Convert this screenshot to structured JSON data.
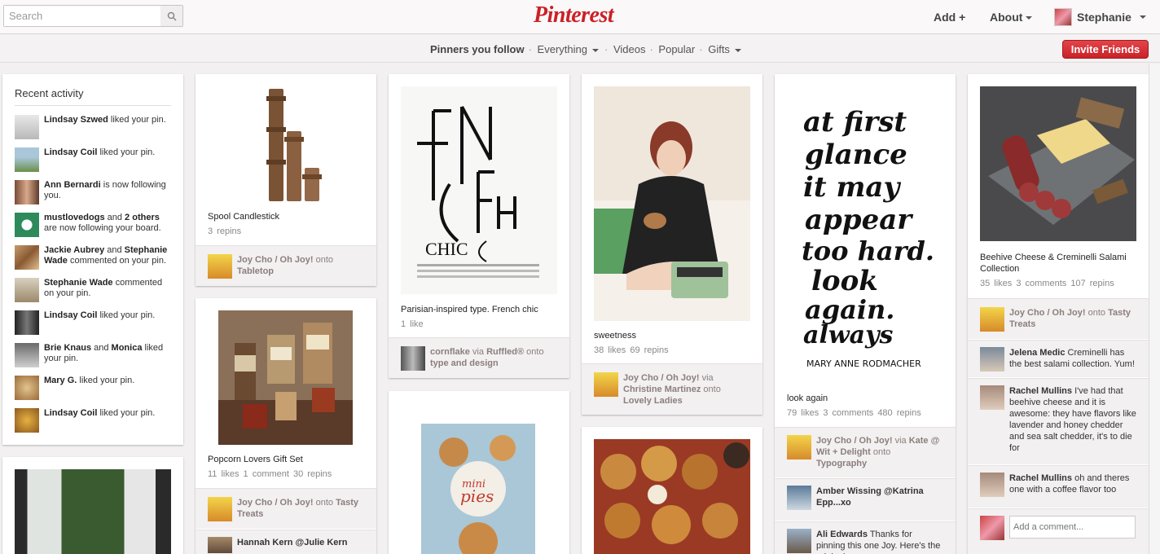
{
  "header": {
    "search_placeholder": "Search",
    "logo": "Pinterest",
    "add_label": "Add +",
    "about_label": "About",
    "user_name": "Stephanie"
  },
  "subnav": {
    "links": [
      "Pinners you follow",
      "Everything",
      "Videos",
      "Popular",
      "Gifts"
    ],
    "invite_label": "Invite Friends"
  },
  "recent_activity": {
    "title": "Recent activity",
    "items": [
      {
        "actor": "Lindsay Szwed",
        "text": " liked your pin."
      },
      {
        "actor": "Lindsay Coil",
        "text": " liked your pin."
      },
      {
        "actor": "Ann Bernardi",
        "text": " is now following you."
      },
      {
        "actor": "mustlovedogs",
        "text": " and ",
        "actor2": "2 others",
        "text2": " are now following your board."
      },
      {
        "actor": "Jackie Aubrey",
        "text": " and ",
        "actor2": "Stephanie Wade",
        "text2": " commented on your pin."
      },
      {
        "actor": "Stephanie Wade",
        "text": " commented on your pin."
      },
      {
        "actor": "Lindsay Coil",
        "text": " liked your pin."
      },
      {
        "actor": "Brie Knaus",
        "text": " and ",
        "actor2": "Monica",
        "text2": " liked your pin."
      },
      {
        "actor": "Mary G.",
        "text": " liked your pin."
      },
      {
        "actor": "Lindsay Coil",
        "text": " liked your pin."
      }
    ]
  },
  "pins": {
    "spool": {
      "title": "Spool Candlestick",
      "stats": "3 repins",
      "user": "Joy Cho / Oh Joy!",
      "onto": "onto",
      "board": "Tabletop"
    },
    "popcorn": {
      "title": "Popcorn Lovers Gift Set",
      "stats": "11 likes  1 comment  30 repins",
      "user": "Joy Cho / Oh Joy!",
      "onto": "onto",
      "board": "Tasty Treats",
      "next_user": "Hannah Kern @Julie Kern"
    },
    "french": {
      "title": "Parisian-inspired type. French chic",
      "stats": "1 like",
      "user": "cornflake",
      "via": "via",
      "via_user": "Ruffled®",
      "onto": "onto",
      "board": "type and design",
      "image_text": "FRENCH CHIC"
    },
    "minipies": {
      "image_text": "mini pies"
    },
    "sweetness": {
      "title": "sweetness",
      "stats": "38 likes  69 repins",
      "user": "Joy Cho / Oh Joy!",
      "via": "via",
      "via_user": "Christine Martinez",
      "onto": "onto",
      "board": "Lovely Ladies"
    },
    "lookagain": {
      "title": "look again",
      "stats": "79 likes  3 comments  480 repins",
      "user": "Joy Cho / Oh Joy!",
      "via": "via",
      "via_user": "Kate @ Wit + Delight",
      "onto": "onto",
      "board": "Typography",
      "comment1_user": "Amber Wissing",
      "comment1_text": "@Katrina Epp...xo",
      "comment2_user": "Ali Edwards",
      "comment2_text": "Thanks for pinning this one Joy. Here's the original",
      "quote": "at first glance it may appear too hard. look again. always look again.",
      "author": "MARY ANNE RODMACHER"
    },
    "cheese": {
      "title": "Beehive Cheese & Creminelli Salami Collection",
      "stats": "35 likes  3 comments  107 repins",
      "user": "Joy Cho / Oh Joy!",
      "onto": "onto",
      "board": "Tasty Treats",
      "comment1_user": "Jelena Medic",
      "comment1_text": "Creminelli has the best salami collection. Yum!",
      "comment2_user": "Rachel Mullins",
      "comment2_text": "I've had that beehive cheese and it is awesome: they have flavors like lavender and honey chedder and sea salt chedder, it's to die for",
      "comment3_user": "Rachel Mullins",
      "comment3_text": "oh and theres one with a coffee flavor too",
      "comment_placeholder": "Add a comment..."
    }
  },
  "colors": {
    "brand": "#cb2027",
    "background": "#f2f0f0"
  }
}
